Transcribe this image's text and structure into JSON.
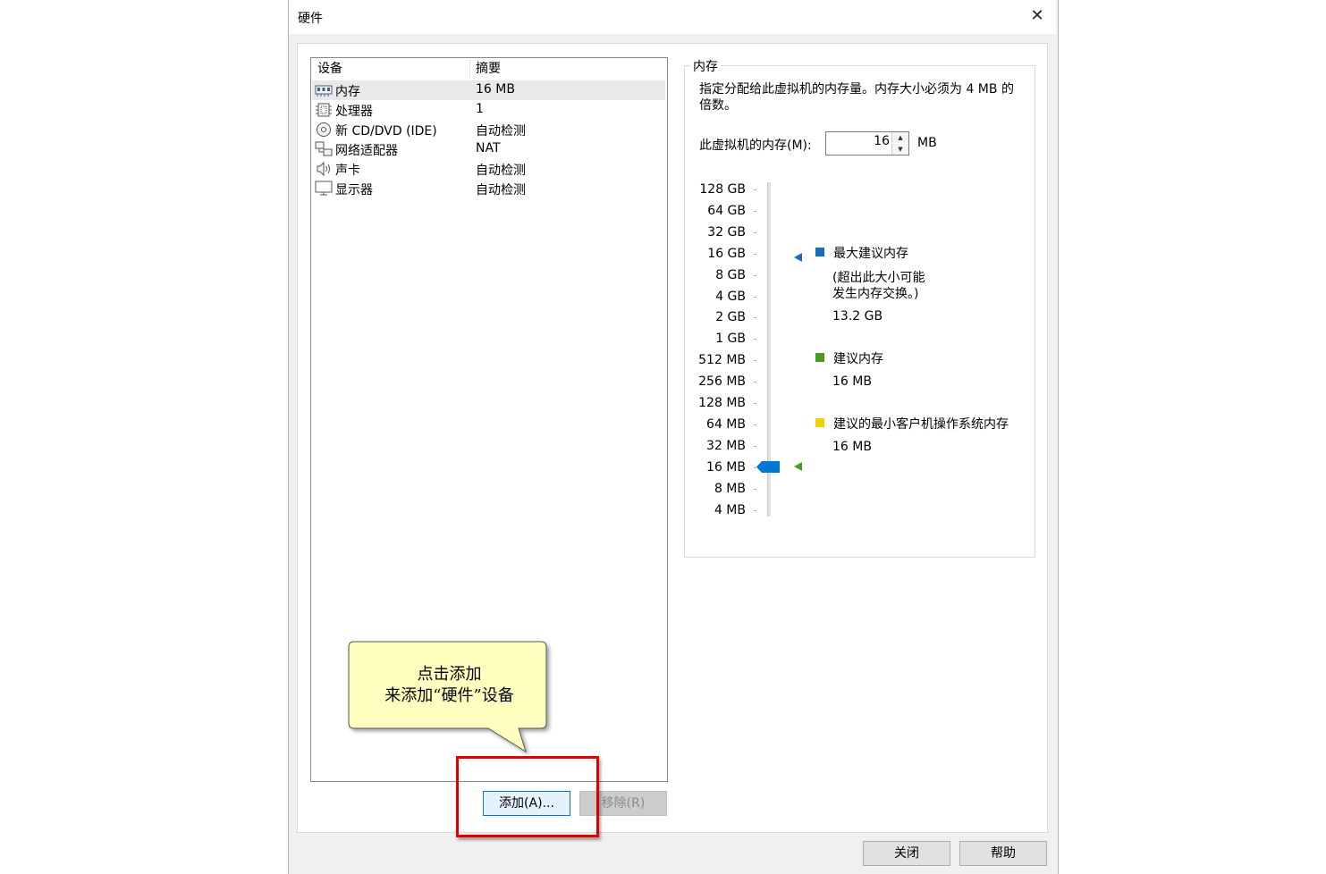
{
  "window": {
    "title": "硬件",
    "close_glyph": "✕"
  },
  "device_list": {
    "columns": [
      "设备",
      "摘要"
    ],
    "rows": [
      {
        "name": "内存",
        "summary": "16 MB",
        "icon": "memory-icon",
        "selected": true
      },
      {
        "name": "处理器",
        "summary": "1",
        "icon": "processor-icon"
      },
      {
        "name": "新 CD/DVD (IDE)",
        "summary": "自动检测",
        "icon": "cd-dvd-icon"
      },
      {
        "name": "网络适配器",
        "summary": "NAT",
        "icon": "network-adapter-icon"
      },
      {
        "name": "声卡",
        "summary": "自动检测",
        "icon": "sound-card-icon"
      },
      {
        "name": "显示器",
        "summary": "自动检测",
        "icon": "display-icon"
      }
    ]
  },
  "memory": {
    "group_title": "内存",
    "description": "指定分配给此虚拟机的内存量。内存大小必须为 4 MB 的倍数。",
    "field_label": "此虚拟机的内存(M):",
    "value": "16",
    "unit": "MB",
    "scale_labels": [
      "128 GB",
      "64 GB",
      "32 GB",
      "16 GB",
      "8 GB",
      "4 GB",
      "2 GB",
      "1 GB",
      "512 MB",
      "256 MB",
      "128 MB",
      "64 MB",
      "32 MB",
      "16 MB",
      "8 MB",
      "4 MB"
    ],
    "legend": {
      "max_recommended": {
        "label": "最大建议内存",
        "note_line1": "(超出此大小可能",
        "note_line2": "发生内存交换。)",
        "value": "13.2 GB",
        "color": "#1a6bb8"
      },
      "recommended": {
        "label": "建议内存",
        "value": "16 MB",
        "color": "#4b9a1f"
      },
      "guest_min": {
        "label": "建议的最小客户机操作系统内存",
        "value": "16 MB",
        "color": "#f5d000"
      }
    },
    "slider_color": "#0078d7"
  },
  "buttons": {
    "add": "添加(A)...",
    "remove": "移除(R)",
    "close": "关闭",
    "help": "帮助"
  },
  "annotation": {
    "line1": "点击添加",
    "line2": "来添加“硬件”设备",
    "bubble_color": "#ffffc0",
    "highlight_color": "#e00000"
  }
}
